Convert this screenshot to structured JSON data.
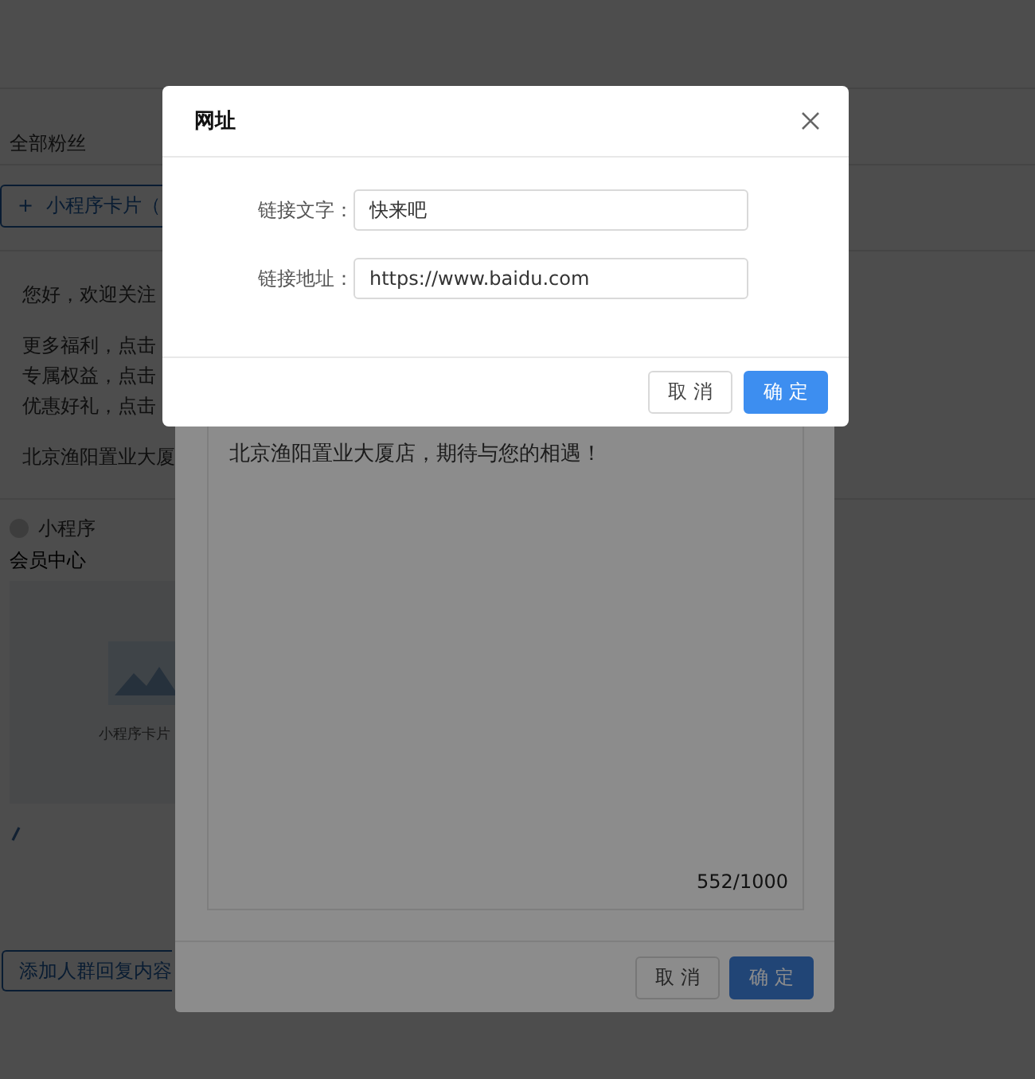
{
  "page": {
    "audience": "全部粉丝",
    "add_card_button": {
      "icon": "+",
      "label": "小程序卡片（"
    },
    "greeting": "您好，欢迎关注",
    "message_lines": [
      "更多福利，点击",
      "专属权益，点击",
      "优惠好礼，点击"
    ],
    "closing": "北京渔阳置业大厦",
    "mini_program": {
      "label": "小程序",
      "title": "会员中心",
      "caption": "小程序卡片"
    },
    "add_reply_button": "添加人群回复内容"
  },
  "editor_dialog": {
    "text": "北京渔阳置业大厦店，期待与您的相遇！",
    "counter": "552/1000",
    "buttons": [
      {
        "label": "取 消",
        "kind": "default"
      },
      {
        "label": "确 定",
        "kind": "primary"
      }
    ]
  },
  "link_dialog": {
    "title": "网址",
    "fields": [
      {
        "label": "链接文字：",
        "value": "快来吧"
      },
      {
        "label": "链接地址：",
        "value": "https://www.baidu.com"
      }
    ],
    "buttons": [
      {
        "label": "取 消",
        "kind": "default"
      },
      {
        "label": "确 定",
        "kind": "primary"
      }
    ]
  }
}
